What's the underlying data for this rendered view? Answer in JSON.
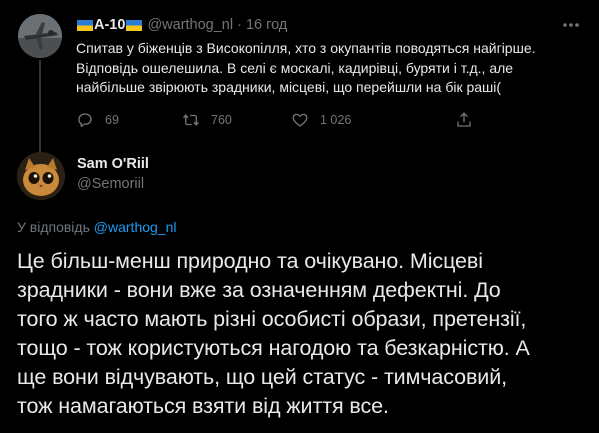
{
  "parent_tweet": {
    "display_name": "A-10",
    "handle": "@warthog_nl",
    "separator": "·",
    "time": "16 год",
    "text_lines": [
      "Спитав у біженців з Високопілля, хто з окупантів поводяться найгірше.",
      "Відповідь ошелешила. В селі є москалі, кадирівці, буряти і т.д., але",
      "найбільше звірюють зрадники, місцеві, що перейшли на бік раші("
    ],
    "actions": {
      "replies": "69",
      "retweets": "760",
      "likes": "1 026"
    }
  },
  "reply": {
    "display_name": "Sam O'Riil",
    "handle": "@Semoriil",
    "replying_to_label": "У відповідь",
    "replying_to_handle": "@warthog_nl",
    "text_lines": [
      "Це більш-менш природно та очікувано. Місцеві",
      "зрадники - вони вже за означенням дефектні. До",
      "того ж часто мають різні особисті образи, претензії,",
      "тощо - тож користуються нагодою та безкарністю. А",
      "ще вони відчувають, що цей статус -  тимчасовий,",
      "тож намагаються взяти від життя все."
    ]
  },
  "colors": {
    "background": "#000000",
    "text": "#e7e9ea",
    "muted": "#71767b",
    "link": "#1d9bf0"
  },
  "icons": [
    "more-icon",
    "reply-icon",
    "retweet-icon",
    "like-icon",
    "share-icon",
    "ukraine-flag-icon"
  ]
}
